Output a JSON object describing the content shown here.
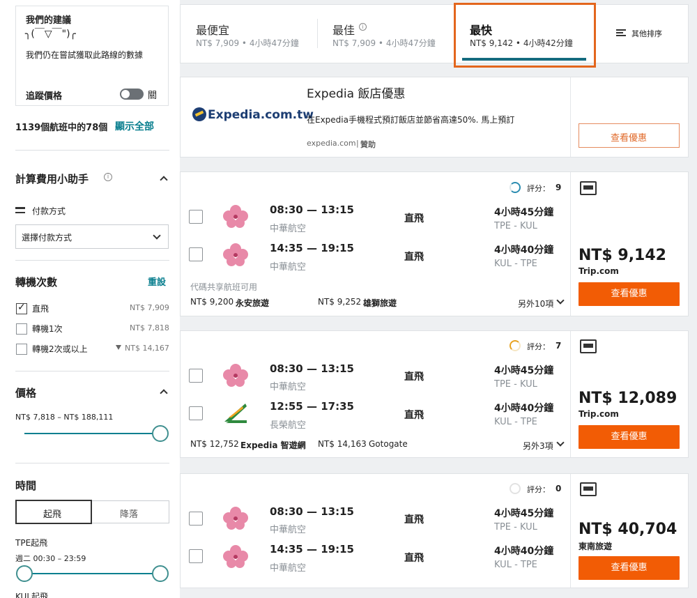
{
  "sidebar": {
    "advice": {
      "title": "我們的建議",
      "face": "╮(￣▽￣\")╭",
      "message": "我們仍在嘗試獲取此路線的數據",
      "track_label": "追蹤價格",
      "toggle_state": "關"
    },
    "results_count_text": "1139個航班中的78個",
    "show_all": "顯示全部",
    "fee_assistant": {
      "title": "計算費用小助手",
      "payment_label": "付款方式",
      "payment_select": "選擇付款方式"
    },
    "stops": {
      "title": "轉機次數",
      "reset": "重設",
      "items": [
        {
          "label": "直飛",
          "price": "NT$ 7,909",
          "checked": true
        },
        {
          "label": "轉機1次",
          "price": "NT$ 7,818",
          "checked": false
        },
        {
          "label": "轉機2次或以上",
          "price": "NT$ 14,167",
          "checked": false
        }
      ]
    },
    "price_filter": {
      "title": "價格",
      "range": "NT$ 7,818 – NT$ 188,111"
    },
    "time_filter": {
      "title": "時間",
      "tab_departure": "起飛",
      "tab_arrival": "降落",
      "origin_label": "TPE起飛",
      "range": "週二 00:30 – 23:59",
      "next_label": "KUL起飛"
    }
  },
  "sort_tabs": {
    "cheapest": {
      "label": "最便宜",
      "sub": "NT$ 7,909 • 4小時47分鐘"
    },
    "best": {
      "label": "最佳",
      "sub": "NT$ 7,909 • 4小時47分鐘"
    },
    "fastest": {
      "label": "最快",
      "sub": "NT$ 9,142 • 4小時42分鐘"
    },
    "other": {
      "label": "其他排序"
    }
  },
  "ad": {
    "logo_text": "Expedia.com.tw",
    "title": "Expedia 飯店優惠",
    "body": "在Expedia手機程式預訂飯店並節省高達50%. 馬上預訂",
    "domain": "expedia.com",
    "sponsored": "贊助",
    "cta": "查看優惠"
  },
  "results": [
    {
      "score_label": "評分：",
      "score": "9",
      "legs": [
        {
          "time": "08:30 — 13:15",
          "airline": "中華航空",
          "type": "直飛",
          "duration": "4小時45分鐘",
          "route": "TPE - KUL",
          "logo": "china-airlines"
        },
        {
          "time": "14:35 — 19:15",
          "airline": "中華航空",
          "type": "直飛",
          "duration": "4小時40分鐘",
          "route": "KUL - TPE",
          "logo": "china-airlines"
        }
      ],
      "codeshare": "代碼共享航班可用",
      "alt_prices": [
        {
          "price": "NT$ 9,200",
          "provider": "永安旅遊"
        },
        {
          "price": "NT$ 9,252",
          "provider": "雄獅旅遊"
        }
      ],
      "more": "另外10項",
      "price": "NT$ 9,142",
      "provider": "Trip.com",
      "cta": "查看優惠",
      "score_color": "#2a8cb0"
    },
    {
      "score_label": "評分：",
      "score": "7",
      "legs": [
        {
          "time": "08:30 — 13:15",
          "airline": "中華航空",
          "type": "直飛",
          "duration": "4小時45分鐘",
          "route": "TPE - KUL",
          "logo": "china-airlines"
        },
        {
          "time": "12:55 — 17:35",
          "airline": "長榮航空",
          "type": "直飛",
          "duration": "4小時40分鐘",
          "route": "KUL - TPE",
          "logo": "eva-air"
        }
      ],
      "codeshare": "",
      "alt_prices": [
        {
          "price": "NT$ 12,752",
          "provider": "Expedia 智遊網"
        },
        {
          "price": "NT$ 14,163",
          "provider": "Gotogate"
        }
      ],
      "more": "另外3項",
      "price": "NT$ 12,089",
      "provider": "Trip.com",
      "cta": "查看優惠",
      "score_color": "#e8a322"
    },
    {
      "score_label": "評分：",
      "score": "0",
      "legs": [
        {
          "time": "08:30 — 13:15",
          "airline": "中華航空",
          "type": "直飛",
          "duration": "4小時45分鐘",
          "route": "TPE - KUL",
          "logo": "china-airlines"
        },
        {
          "time": "14:35 — 19:15",
          "airline": "中華航空",
          "type": "直飛",
          "duration": "4小時40分鐘",
          "route": "KUL - TPE",
          "logo": "china-airlines"
        }
      ],
      "codeshare": "",
      "alt_prices": [],
      "more": "",
      "price": "NT$ 40,704",
      "provider": "東南旅遊",
      "cta": "查看優惠",
      "score_color": "#dddddd"
    }
  ],
  "colors": {
    "accent_orange": "#f25c05",
    "teal": "#146b7f",
    "highlight_box": "#e3661d"
  }
}
